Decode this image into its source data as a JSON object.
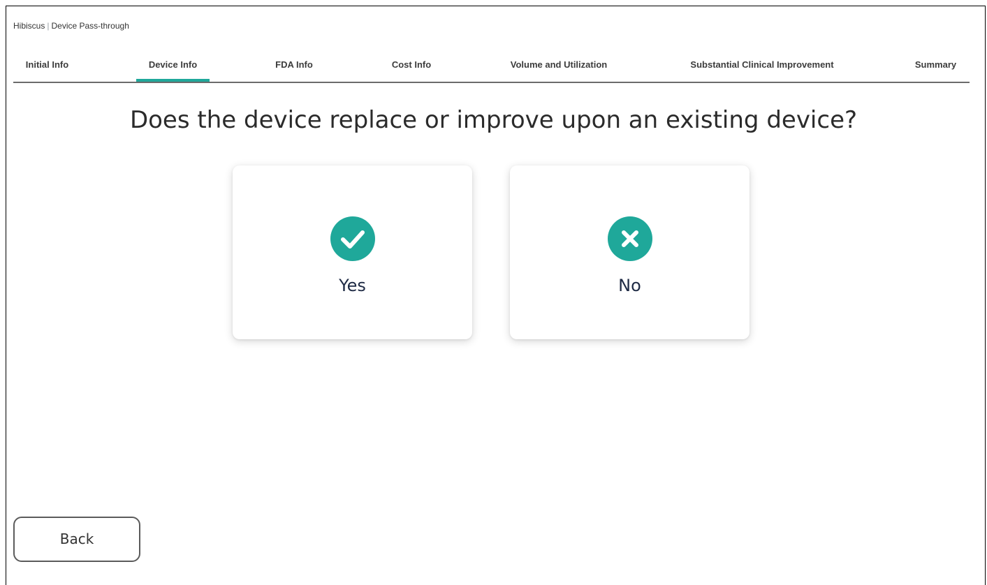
{
  "breadcrumb": {
    "app": "Hibiscus",
    "separator": "|",
    "page": "Device Pass-through"
  },
  "tabs": [
    {
      "label": "Initial Info",
      "active": false
    },
    {
      "label": "Device Info",
      "active": true
    },
    {
      "label": "FDA Info",
      "active": false
    },
    {
      "label": "Cost Info",
      "active": false
    },
    {
      "label": "Volume and Utilization",
      "active": false
    },
    {
      "label": "Substantial Clinical Improvement",
      "active": false
    },
    {
      "label": "Summary",
      "active": false
    }
  ],
  "question": "Does the device replace or improve upon an existing device?",
  "options": {
    "yes": {
      "label": "Yes",
      "icon": "check-circle-icon"
    },
    "no": {
      "label": "No",
      "icon": "x-circle-icon"
    }
  },
  "back_label": "Back",
  "colors": {
    "accent": "#1fa89a",
    "text_dark": "#1e2a44"
  }
}
